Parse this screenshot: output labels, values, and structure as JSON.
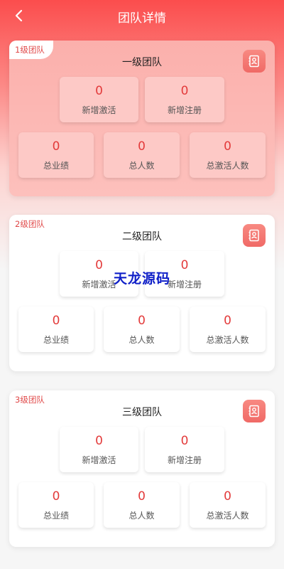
{
  "header": {
    "title": "团队详情"
  },
  "teams": [
    {
      "tag": "1级团队",
      "title": "一级团队",
      "new_active": {
        "value": "0",
        "label": "新增激活"
      },
      "new_register": {
        "value": "0",
        "label": "新增注册"
      },
      "total_performance": {
        "value": "0",
        "label": "总业绩"
      },
      "total_people": {
        "value": "0",
        "label": "总人数"
      },
      "total_active_people": {
        "value": "0",
        "label": "总激活人数"
      }
    },
    {
      "tag": "2级团队",
      "title": "二级团队",
      "new_active": {
        "value": "0",
        "label": "新增激活"
      },
      "new_register": {
        "value": "0",
        "label": "新增注册"
      },
      "total_performance": {
        "value": "0",
        "label": "总业绩"
      },
      "total_people": {
        "value": "0",
        "label": "总人数"
      },
      "total_active_people": {
        "value": "0",
        "label": "总激活人数"
      }
    },
    {
      "tag": "3级团队",
      "title": "三级团队",
      "new_active": {
        "value": "0",
        "label": "新增激活"
      },
      "new_register": {
        "value": "0",
        "label": "新增注册"
      },
      "total_performance": {
        "value": "0",
        "label": "总业绩"
      },
      "total_people": {
        "value": "0",
        "label": "总人数"
      },
      "total_active_people": {
        "value": "0",
        "label": "总激活人数"
      }
    }
  ],
  "watermark": "天龙源码",
  "colors": {
    "accent": "#fb4d4d",
    "value_red": "#e33b3b"
  }
}
